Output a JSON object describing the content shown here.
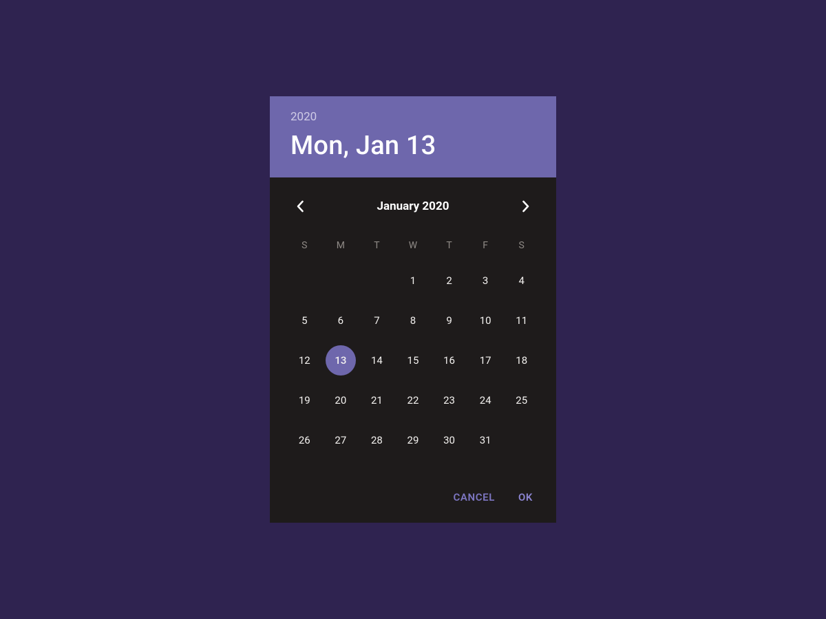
{
  "colors": {
    "page_bg": "#2f2350",
    "panel_bg": "#1e1b1b",
    "accent": "#6e67ac",
    "accent_text": "#7d76c2"
  },
  "header": {
    "year_label": "2020",
    "date_label": "Mon, Jan 13"
  },
  "calendar": {
    "month_label": "January 2020",
    "prev_icon": "chevron-left",
    "next_icon": "chevron-right",
    "weekday_labels": [
      "S",
      "M",
      "T",
      "W",
      "T",
      "F",
      "S"
    ],
    "leading_blanks": 3,
    "days": [
      "1",
      "2",
      "3",
      "4",
      "5",
      "6",
      "7",
      "8",
      "9",
      "10",
      "11",
      "12",
      "13",
      "14",
      "15",
      "16",
      "17",
      "18",
      "19",
      "20",
      "21",
      "22",
      "23",
      "24",
      "25",
      "26",
      "27",
      "28",
      "29",
      "30",
      "31"
    ],
    "selected_day": "13"
  },
  "actions": {
    "cancel_label": "CANCEL",
    "ok_label": "OK"
  }
}
